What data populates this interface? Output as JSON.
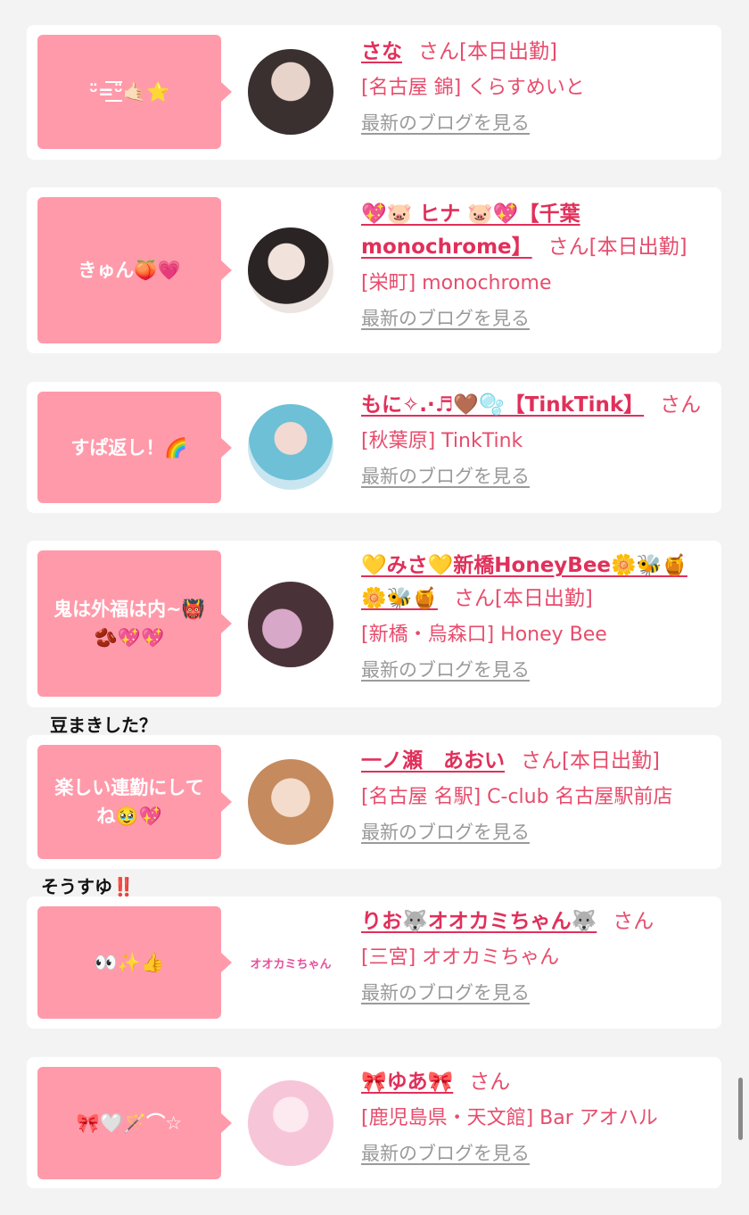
{
  "entries": [
    {
      "bubble": "ᵕ̈=͟͟͞͞ᵕ̈🤙🏻⭐",
      "name": "さな",
      "san": "さん",
      "status": "[本日出勤]",
      "shop": "[名古屋 錦] くらすめいと",
      "blog": "最新のブログを見る",
      "avatar_colors": [
        "#3a3030",
        "#d9c2b8"
      ]
    },
    {
      "bubble": "きゅん🍑💗",
      "name": "💖🐷 ヒナ 🐷💖【千葉monochrome】",
      "san": "さん",
      "status": "[本日出勤]",
      "shop": "[栄町] monochrome",
      "blog": "最新のブログを見る",
      "avatar_colors": [
        "#2b2424",
        "#f1e9e4"
      ]
    },
    {
      "bubble": "すぱ返し！🌈",
      "name": "もに✧.·♬🤎🫧【TinkTink】",
      "san": "さん",
      "status": "",
      "shop": "[秋葉原] TinkTink",
      "blog": "最新のブログを見る",
      "avatar_colors": [
        "#6dc0d6",
        "#f4cfe2"
      ]
    },
    {
      "bubble": "鬼は外福は内~👹🫘💖💖",
      "name": "💛みさ💛新橋HoneyBee🌼🐝🍯🌼🐝🍯",
      "san": "さん",
      "status": "[本日出勤]",
      "shop": "[新橋・烏森口] Honey Bee",
      "blog": "最新のブログを見る",
      "avatar_colors": [
        "#4a3338",
        "#d8a8c8"
      ]
    },
    {
      "bubble": "楽しい連勤にしてね🥹💖",
      "name": "一ノ瀬　あおい",
      "san": "さん",
      "status": "[本日出勤]",
      "shop": "[名古屋 名駅] C-club 名古屋駅前店",
      "blog": "最新のブログを見る",
      "avatar_colors": [
        "#c58a5d",
        "#f3dccb"
      ]
    },
    {
      "bubble": "👀✨👍",
      "name": "りお🐺オオカミちゃん🐺",
      "san": "さん",
      "status": "",
      "shop": "[三宮] オオカミちゃん",
      "blog": "最新のブログを見る",
      "avatar_colors": [
        "#ffffff",
        "#ffffff"
      ],
      "avatar_logo": "オオカミちゃん"
    },
    {
      "bubble": "🎀🤍🪄⌒☆",
      "name": "🎀ゆあ🎀",
      "san": "さん",
      "status": "",
      "shop": "[鹿児島県・天文館] Bar アオハル",
      "blog": "最新のブログを見る",
      "avatar_colors": [
        "#f7c5d8",
        "#fde9f0"
      ]
    }
  ],
  "comments": [
    {
      "text": "豆まきした？",
      "bang": ""
    },
    {
      "text": "そうすゆ",
      "bang": "‼️"
    }
  ]
}
